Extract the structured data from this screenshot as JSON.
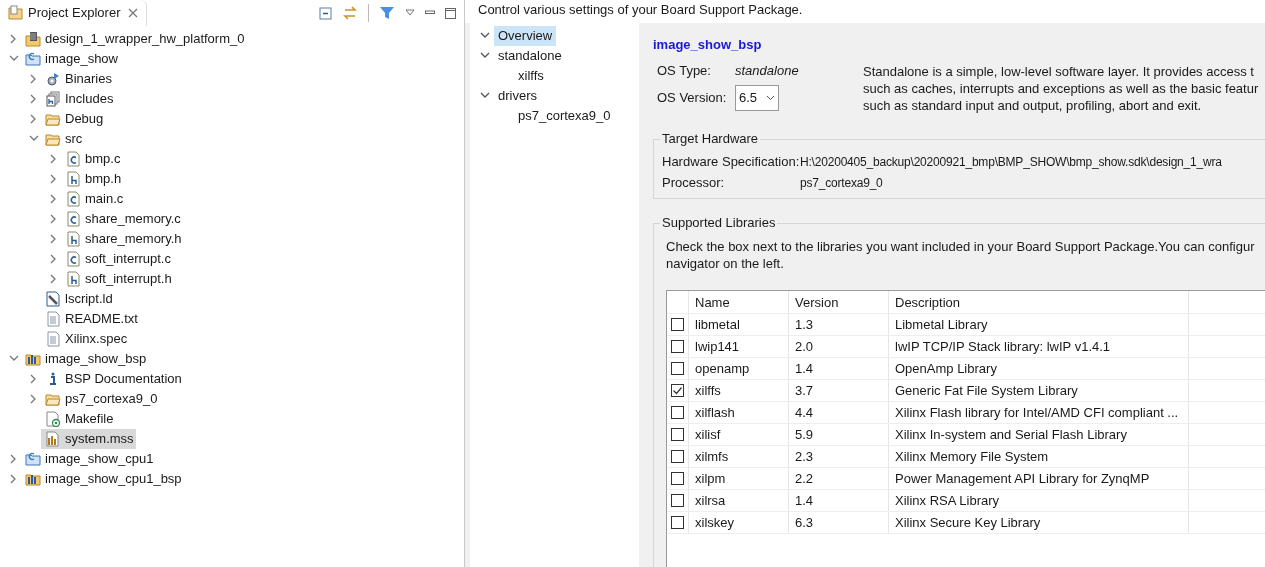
{
  "explorer": {
    "title": "Project Explorer",
    "tree": [
      {
        "label": "design_1_wrapper_hw_platform_0",
        "kind": "hw",
        "expanded": false,
        "selected": false
      },
      {
        "label": "image_show",
        "kind": "cproject",
        "expanded": true,
        "selected": false,
        "children": [
          {
            "label": "Binaries",
            "kind": "binaries",
            "expanded": false,
            "selected": false
          },
          {
            "label": "Includes",
            "kind": "includes",
            "expanded": false,
            "selected": false
          },
          {
            "label": "Debug",
            "kind": "folder",
            "expanded": false,
            "selected": false
          },
          {
            "label": "src",
            "kind": "folder",
            "expanded": true,
            "selected": false,
            "children": [
              {
                "label": "bmp.c",
                "kind": "cfile",
                "expanded": false,
                "selected": false
              },
              {
                "label": "bmp.h",
                "kind": "hfile",
                "expanded": false,
                "selected": false
              },
              {
                "label": "main.c",
                "kind": "cfile",
                "expanded": false,
                "selected": false
              },
              {
                "label": "share_memory.c",
                "kind": "cfile",
                "expanded": false,
                "selected": false
              },
              {
                "label": "share_memory.h",
                "kind": "hfile",
                "expanded": false,
                "selected": false
              },
              {
                "label": "soft_interrupt.c",
                "kind": "cfile",
                "expanded": false,
                "selected": false
              },
              {
                "label": "soft_interrupt.h",
                "kind": "hfile",
                "expanded": false,
                "selected": false
              }
            ]
          },
          {
            "label": "lscript.ld",
            "kind": "linker",
            "selected": false
          },
          {
            "label": "README.txt",
            "kind": "text",
            "selected": false
          },
          {
            "label": "Xilinx.spec",
            "kind": "text",
            "selected": false
          }
        ]
      },
      {
        "label": "image_show_bsp",
        "kind": "bsp",
        "expanded": true,
        "selected": false,
        "children": [
          {
            "label": "BSP Documentation",
            "kind": "info",
            "expanded": false,
            "selected": false
          },
          {
            "label": "ps7_cortexa9_0",
            "kind": "folder",
            "expanded": false,
            "selected": false
          },
          {
            "label": "Makefile",
            "kind": "makefile",
            "selected": false
          },
          {
            "label": "system.mss",
            "kind": "mss",
            "selected": true
          }
        ]
      },
      {
        "label": "image_show_cpu1",
        "kind": "cproject",
        "expanded": false,
        "selected": false
      },
      {
        "label": "image_show_cpu1_bsp",
        "kind": "bsp",
        "expanded": false,
        "selected": false
      }
    ]
  },
  "editor": {
    "header": "Control various settings of your Board Support Package.",
    "nav": [
      {
        "label": "Overview",
        "expanded": true,
        "selected": true
      },
      {
        "label": "standalone",
        "expanded": true,
        "selected": false,
        "children": [
          {
            "label": "xilffs",
            "selected": false
          }
        ]
      },
      {
        "label": "drivers",
        "expanded": true,
        "selected": false,
        "children": [
          {
            "label": "ps7_cortexa9_0",
            "selected": false
          }
        ]
      }
    ],
    "title": "image_show_bsp",
    "os_type_label": "OS Type:",
    "os_type": "standalone",
    "os_version_label": "OS Version:",
    "os_version": "6.5",
    "os_description": "Standalone is a simple, low-level software layer. It provides access t\nsuch as caches, interrupts and exceptions as well as the basic featur\nsuch as standard input and output, profiling, abort and exit.",
    "target_hardware": {
      "title": "Target Hardware",
      "rows": [
        {
          "label": "Hardware Specification:",
          "value": "H:\\20200405_backup\\20200921_bmp\\BMP_SHOW\\bmp_show.sdk\\design_1_wra"
        },
        {
          "label": "Processor:",
          "value": "ps7_cortexa9_0"
        }
      ]
    },
    "libraries": {
      "title": "Supported Libraries",
      "hint": "Check the box next to the libraries you want included in your Board Support Package.You can configur\nnavigator on the left.",
      "columns": [
        "Name",
        "Version",
        "Description"
      ],
      "rows": [
        {
          "name": "libmetal",
          "version": "1.3",
          "description": "Libmetal Library",
          "checked": false
        },
        {
          "name": "lwip141",
          "version": "2.0",
          "description": "lwIP TCP/IP Stack library: lwIP v1.4.1",
          "checked": false
        },
        {
          "name": "openamp",
          "version": "1.4",
          "description": "OpenAmp Library",
          "checked": false
        },
        {
          "name": "xilffs",
          "version": "3.7",
          "description": "Generic Fat File System Library",
          "checked": true
        },
        {
          "name": "xilflash",
          "version": "4.4",
          "description": "Xilinx Flash library for Intel/AMD CFI compliant ...",
          "checked": false
        },
        {
          "name": "xilisf",
          "version": "5.9",
          "description": "Xilinx In-system and Serial Flash Library",
          "checked": false
        },
        {
          "name": "xilmfs",
          "version": "2.3",
          "description": "Xilinx Memory File System",
          "checked": false
        },
        {
          "name": "xilpm",
          "version": "2.2",
          "description": "Power Management API Library for ZynqMP",
          "checked": false
        },
        {
          "name": "xilrsa",
          "version": "1.4",
          "description": "Xilinx RSA Library",
          "checked": false
        },
        {
          "name": "xilskey",
          "version": "6.3",
          "description": "Xilinx Secure Key Library",
          "checked": false
        }
      ]
    }
  }
}
